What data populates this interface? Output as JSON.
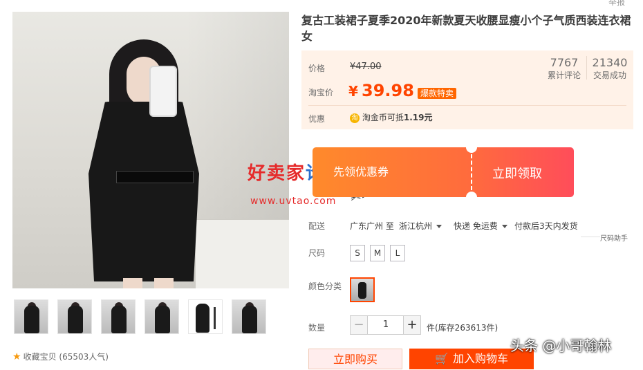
{
  "product": {
    "title": "复古工装裙子夏季2020年新款夏天收腰显瘦小个子气质西装连衣裙女",
    "top_link": "举报"
  },
  "price": {
    "orig_label": "价格",
    "orig_value": "¥47.00",
    "taobao_label": "淘宝价",
    "currency": "¥",
    "value": "39.98",
    "badge": "爆款特卖",
    "reviews_num": "7767",
    "reviews_label": "累计评论",
    "deals_num": "21340",
    "deals_label": "交易成功",
    "promo_label": "优惠",
    "promo_coin": "淘",
    "promo_text_prefix": "淘金币可抵",
    "promo_amount": "1.19元"
  },
  "coupon": {
    "left_text": "先领优惠券",
    "right_text": "立即领取"
  },
  "watermark": {
    "main_a": "好卖家",
    "main_b": "论坛",
    "url": "www.uvtao.com",
    "real": "真实图"
  },
  "shipping": {
    "label": "配送",
    "from": "广东广州 至",
    "to": "浙江杭州",
    "method": "快递 免运费",
    "ship_time": "付款后3天内发货",
    "helper": "尺码助手"
  },
  "size": {
    "label": "尺码",
    "options": [
      "S",
      "M",
      "L"
    ]
  },
  "color": {
    "label": "颜色分类"
  },
  "quantity": {
    "label": "数量",
    "minus": "−",
    "value": "1",
    "plus": "+",
    "stock": "件(库存263613件)"
  },
  "actions": {
    "buy_now": "立即购买",
    "add_cart": "加入购物车"
  },
  "favorite": {
    "star": "★",
    "text": "收藏宝贝",
    "count": "(65503人气)"
  },
  "credit": "头条 @小哥翰林"
}
